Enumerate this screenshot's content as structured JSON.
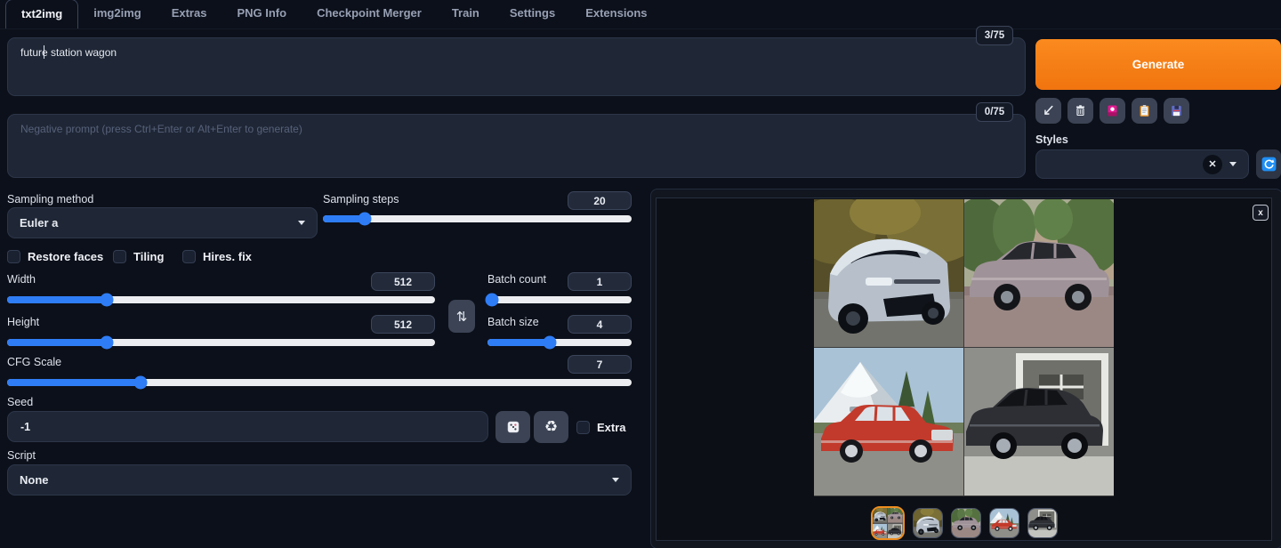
{
  "nav": {
    "tabs": [
      "txt2img",
      "img2img",
      "Extras",
      "PNG Info",
      "Checkpoint Merger",
      "Train",
      "Settings",
      "Extensions"
    ],
    "active_tab": "txt2img"
  },
  "prompt": {
    "value": "future station wagon",
    "counter": "3/75"
  },
  "negative_prompt": {
    "placeholder": "Negative prompt (press Ctrl+Enter or Alt+Enter to generate)",
    "counter": "0/75"
  },
  "actions": {
    "generate_label": "Generate",
    "icons": [
      "arrow-down-left-icon",
      "trash-icon",
      "extra-networks-card-icon",
      "clipboard-icon",
      "save-style-floppy-icon"
    ],
    "close_label": "x"
  },
  "styles": {
    "label": "Styles",
    "value": "",
    "clear_glyph": "✕"
  },
  "controls": {
    "sampling_method": {
      "label": "Sampling method",
      "value": "Euler a"
    },
    "sampling_steps": {
      "label": "Sampling steps",
      "value": "20",
      "pct": 13.5
    },
    "restore_faces": {
      "label": "Restore faces",
      "checked": false
    },
    "tiling": {
      "label": "Tiling",
      "checked": false
    },
    "hires_fix": {
      "label": "Hires. fix",
      "checked": false
    },
    "width": {
      "label": "Width",
      "value": "512",
      "pct": 23.3
    },
    "height": {
      "label": "Height",
      "value": "512",
      "pct": 23.3
    },
    "batch_count": {
      "label": "Batch count",
      "value": "1",
      "pct": 3
    },
    "batch_size": {
      "label": "Batch size",
      "value": "4",
      "pct": 43
    },
    "cfg_scale": {
      "label": "CFG Scale",
      "value": "7",
      "pct": 21.4
    },
    "seed": {
      "label": "Seed",
      "value": "-1",
      "extra_label": "Extra"
    },
    "script": {
      "label": "Script",
      "value": "None"
    },
    "swap_glyph": "⇅",
    "recycle_glyph": "♻"
  },
  "gallery": {
    "selected_index": 0,
    "images": [
      {
        "alt": "2x2 grid montage of four generated station wagon images"
      },
      {
        "alt": "silver futuristic concept station wagon, front three-quarter view, autumn trees"
      },
      {
        "alt": "gray-mauve station wagon side view with green trees"
      },
      {
        "alt": "red vintage station wagon with roof rack, snowy mountain behind"
      },
      {
        "alt": "dark gray station wagon parked in front of a garage"
      }
    ]
  },
  "colors": {
    "accent": "#f57d13",
    "slider_accent": "#2f7df6",
    "selected_thumb_border": "#ef8e1f"
  }
}
